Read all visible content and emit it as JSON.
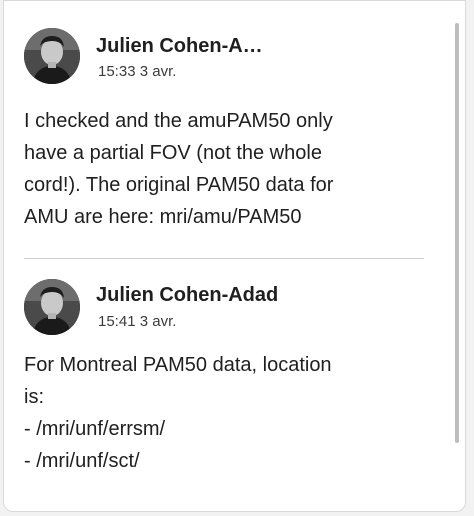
{
  "messages": [
    {
      "author": "Julien Cohen-A…",
      "time": "15:33",
      "date": "3 avr.",
      "body_lines": [
        "I checked and the amuPAM50 only",
        "have a partial FOV (not the whole",
        "cord!). The original PAM50 data for",
        "AMU are here: mri/amu/PAM50"
      ],
      "avatar_icon": "user-avatar-photo"
    },
    {
      "author": "Julien Cohen-Adad",
      "time": "15:41",
      "date": "3 avr.",
      "body_lines": [
        "For Montreal PAM50 data, location",
        "is:",
        "- /mri/unf/errsm/",
        "- /mri/unf/sct/"
      ],
      "avatar_icon": "user-avatar-photo"
    }
  ],
  "colors": {
    "background": "#ffffff",
    "text": "#1f1f1f",
    "meta_text": "#3c3c3c",
    "divider": "#cfcfcf"
  }
}
